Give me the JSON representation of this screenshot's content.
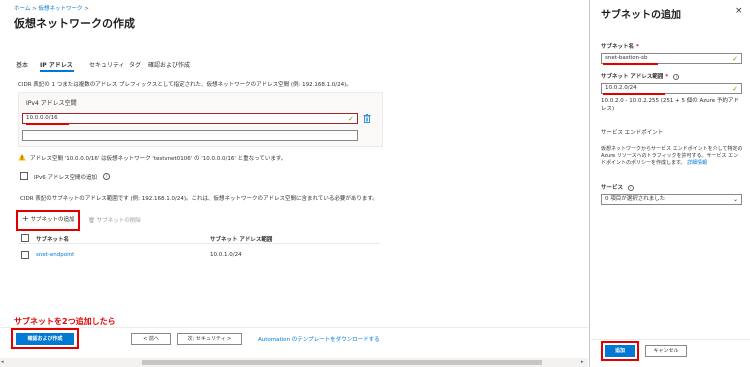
{
  "breadcrumb": {
    "home": "ホーム",
    "sep": ">",
    "current": "仮想ネットワーク",
    "sep2": ">"
  },
  "page_title": "仮想ネットワークの作成",
  "tabs": [
    {
      "label": "基本"
    },
    {
      "label": "IP アドレス",
      "active": true
    },
    {
      "label": "セキュリティ"
    },
    {
      "label": "タグ"
    },
    {
      "label": "確認および作成"
    }
  ],
  "cidr_desc": "CIDR 表記の 1 つまたは複数のアドレス プレフィックスとして指定された、仮想ネットワークのアドレス空間 (例: 192.168.1.0/24)。",
  "ipv4_section": {
    "label": "IPv4 アドレス空間",
    "address": "10.0.0.0/16",
    "empty": ""
  },
  "warning": "アドレス空間 '10.0.0.0/16' は仮想ネットワーク 'testvnet0106' の '10.0.0.0/16' と重なっています。",
  "ipv6_label": "IPv6 アドレス空間の追加",
  "subnet_desc": "CIDR 表記のサブネットのアドレス範囲です (例: 192.168.1.0/24)。これは、仮想ネットワークのアドレス空間に含まれている必要があります。",
  "subnet_actions": {
    "add": "サブネットの追加",
    "delete": "サブネットの削除"
  },
  "subnet_table": {
    "headers": [
      "サブネット名",
      "サブネット アドレス範囲"
    ],
    "rows": [
      {
        "name": "snet-endpoint",
        "range": "10.0.1.0/24"
      }
    ]
  },
  "annotation": "サブネットを2つ追加したら",
  "footer": {
    "review_create": "確認および作成",
    "prev": "< 前へ",
    "next": "次: セキュリティ >",
    "automation": "Automation のテンプレートをダウンロードする"
  },
  "panel": {
    "title": "サブネットの追加",
    "close": "×",
    "name_label": "サブネット名",
    "required": "*",
    "name_value": "snet-bastion-sb",
    "range_label": "サブネット アドレス範囲",
    "range_value": "10.0.2.0/24",
    "range_info": "10.0.2.0 - 10.0.2.255 (251 + 5 個の Azure 予約アドレス)",
    "endpoint_header": "サービス エンドポイント",
    "endpoint_desc": "仮想ネットワークからサービス エンドポイントを介して特定の Azure リソースへのトラフィックを許可する。サービス エンドポイントのポリシーを作成します。",
    "detail_link": "詳細情報",
    "services_label": "サービス",
    "services_value": "0 項目が選択されました",
    "add": "追加",
    "cancel": "キャンセル"
  },
  "colors": {
    "accent": "#0078d4",
    "highlight": "#e00000",
    "success": "#57a300",
    "warning": "#ffb900"
  }
}
